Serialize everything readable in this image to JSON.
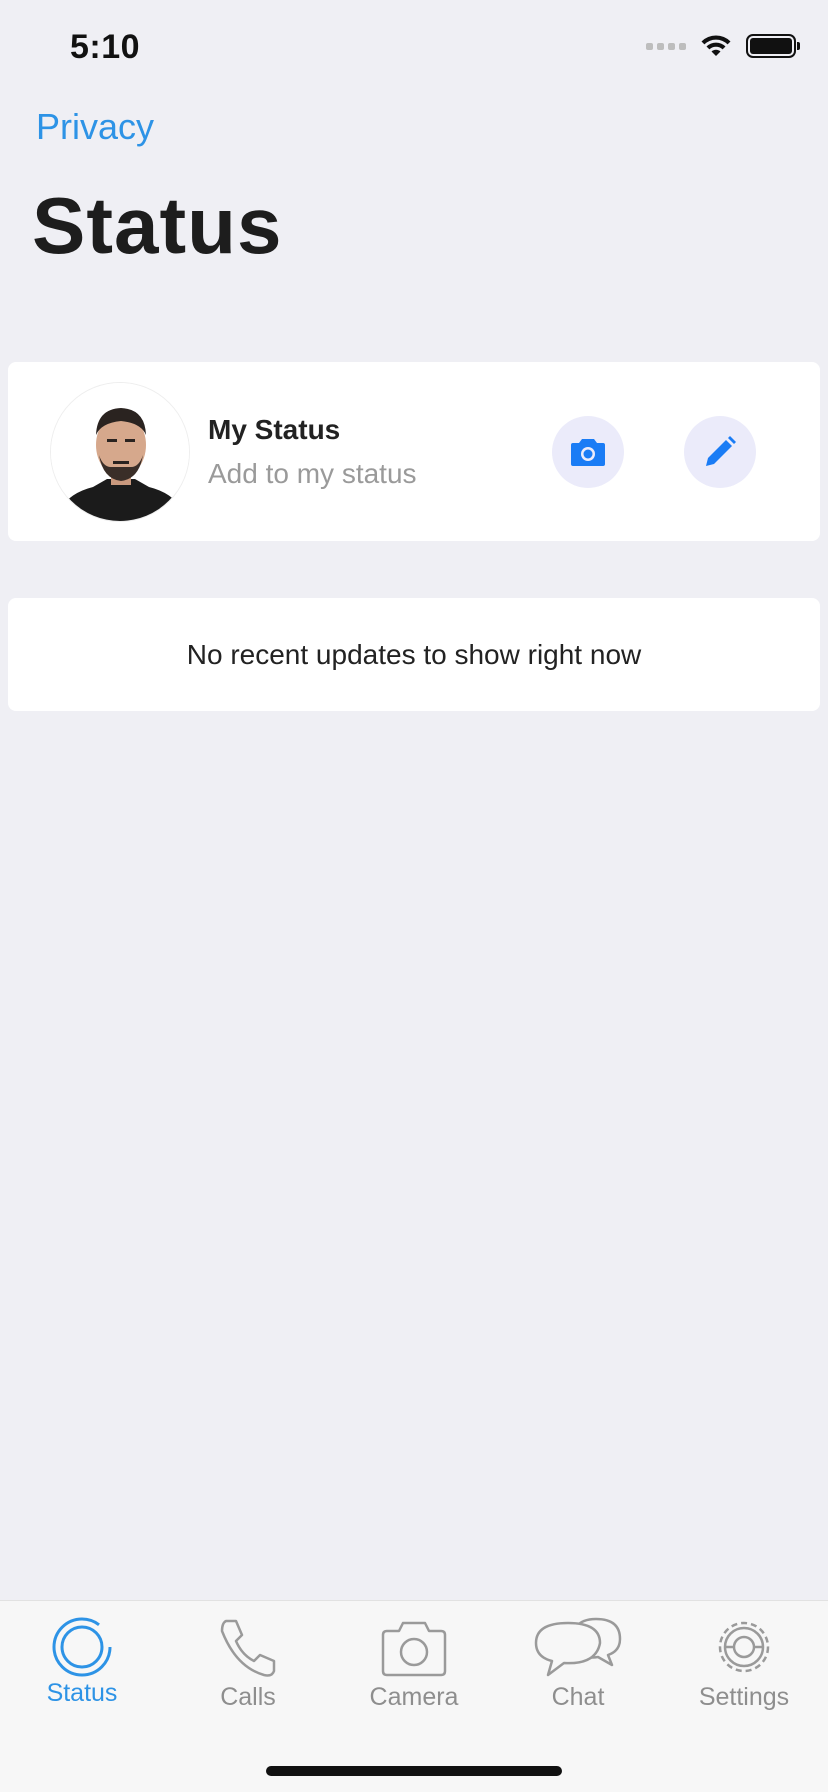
{
  "status_bar": {
    "time": "5:10"
  },
  "header": {
    "back_link": "Privacy",
    "title": "Status"
  },
  "my_status": {
    "name": "My Status",
    "subtitle": "Add to my status",
    "camera_icon": "camera-icon",
    "edit_icon": "pencil-icon"
  },
  "updates": {
    "empty_text": "No recent updates to show right now"
  },
  "tabs": [
    {
      "label": "Status",
      "icon": "status-icon",
      "active": true
    },
    {
      "label": "Calls",
      "icon": "phone-icon",
      "active": false
    },
    {
      "label": "Camera",
      "icon": "camera-icon",
      "active": false
    },
    {
      "label": "Chat",
      "icon": "chat-icon",
      "active": false
    },
    {
      "label": "Settings",
      "icon": "gear-icon",
      "active": false
    }
  ],
  "colors": {
    "accent": "#2d93e6",
    "icon_blue": "#1a7cf5",
    "background": "#efeff4",
    "button_bg": "#ebebfa"
  }
}
